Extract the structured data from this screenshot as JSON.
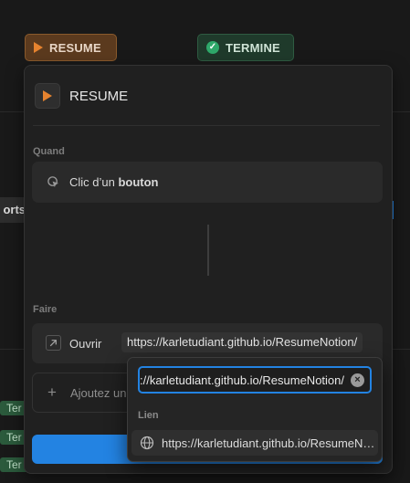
{
  "colors": {
    "accent": "#2383e2",
    "resume_chip": "#5b3a1e",
    "termine_chip": "#1f3a2b",
    "play": "#e6832f",
    "check": "#2fa86a"
  },
  "status_chips": {
    "resume": "RESUME",
    "termine": "TERMINE"
  },
  "background": {
    "tab_fragment": "orts",
    "badges": [
      "Ter",
      "Ter",
      "Ter"
    ]
  },
  "panel": {
    "title": "RESUME",
    "icon": "play-icon",
    "when": {
      "label": "Quand",
      "trigger_prefix": "Clic d’un ",
      "trigger_bold": "bouton",
      "icon": "cursor-click-icon"
    },
    "do": {
      "label": "Faire",
      "action_label": "Ouvrir",
      "action_icon": "arrow-up-right-icon",
      "url": "https://karletudiant.github.io/ResumeNotion/",
      "add_label": "Ajoutez une action"
    }
  },
  "dropdown": {
    "input_value": "https://karletudiant.github.io/ResumeNotion/",
    "section_label": "Lien",
    "item_label": "https://karletudiant.github.io/ResumeNotion/",
    "item_icon": "globe-icon"
  }
}
